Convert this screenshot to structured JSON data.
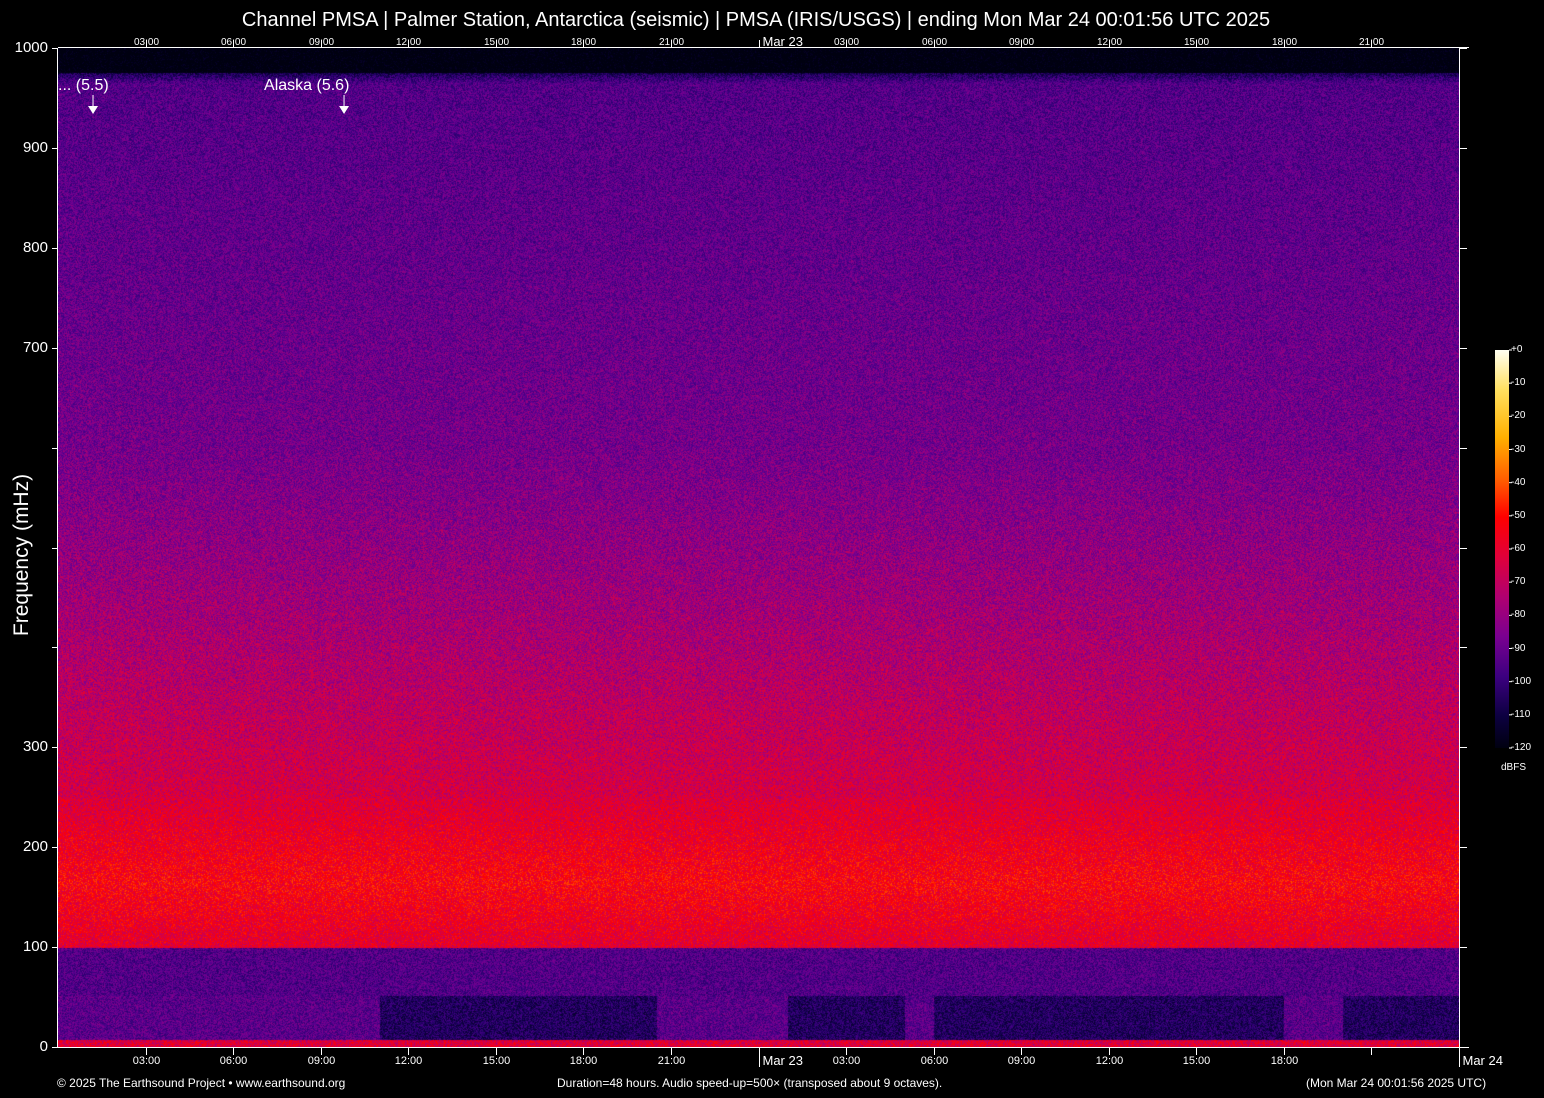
{
  "title": "Channel PMSA | Palmer Station, Antarctica (seismic) | PMSA (IRIS/USGS) | ending Mon Mar 24 00:01:56 UTC 2025",
  "chart_data": {
    "type": "heatmap",
    "title": "Channel PMSA | Palmer Station, Antarctica (seismic) | PMSA (IRIS/USGS) | ending Mon Mar 24 00:01:56 UTC 2025",
    "ylabel": "Frequency (mHz)",
    "ylim": [
      0,
      1000
    ],
    "y_ticks": [
      {
        "v": 1000,
        "label": "1000"
      },
      {
        "v": 900,
        "label": "900"
      },
      {
        "v": 800,
        "label": "800"
      },
      {
        "v": 700,
        "label": "700"
      },
      {
        "v": 600,
        "label": ""
      },
      {
        "v": 500,
        "label": ""
      },
      {
        "v": 400,
        "label": ""
      },
      {
        "v": 300,
        "label": "300"
      },
      {
        "v": 200,
        "label": "200"
      },
      {
        "v": 100,
        "label": "100"
      },
      {
        "v": 0,
        "label": "0"
      }
    ],
    "xlim_hours": [
      0,
      48
    ],
    "top_ticks": [
      {
        "h": 3,
        "label": "03:00"
      },
      {
        "h": 6,
        "label": "06:00"
      },
      {
        "h": 9,
        "label": "09:00"
      },
      {
        "h": 12,
        "label": "12:00"
      },
      {
        "h": 15,
        "label": "15:00"
      },
      {
        "h": 18,
        "label": "18:00"
      },
      {
        "h": 21,
        "label": "21:00"
      },
      {
        "h": 24,
        "label": "Mar 23"
      },
      {
        "h": 27,
        "label": "03:00"
      },
      {
        "h": 30,
        "label": "06:00"
      },
      {
        "h": 33,
        "label": "09:00"
      },
      {
        "h": 36,
        "label": "12:00"
      },
      {
        "h": 39,
        "label": "15:00"
      },
      {
        "h": 42,
        "label": "18:00"
      },
      {
        "h": 45,
        "label": "21:00"
      }
    ],
    "bottom_ticks": [
      {
        "h": 3,
        "label": "03:00"
      },
      {
        "h": 6,
        "label": "06:00"
      },
      {
        "h": 9,
        "label": "09:00"
      },
      {
        "h": 12,
        "label": "12:00"
      },
      {
        "h": 15,
        "label": "15:00"
      },
      {
        "h": 18,
        "label": "18:00"
      },
      {
        "h": 21,
        "label": "21:00"
      },
      {
        "h": 24,
        "label": "Mar 23"
      },
      {
        "h": 27,
        "label": "03:00"
      },
      {
        "h": 30,
        "label": "06:00"
      },
      {
        "h": 33,
        "label": "09:00"
      },
      {
        "h": 36,
        "label": "12:00"
      },
      {
        "h": 39,
        "label": "15:00"
      },
      {
        "h": 42,
        "label": "18:00"
      },
      {
        "h": 45,
        "label": ""
      },
      {
        "h": 48,
        "label": "Mar 24"
      }
    ],
    "annotations": [
      {
        "h": 1.2,
        "label": "... (5.5)"
      },
      {
        "h": 9.8,
        "label": "Alaska (5.6)"
      }
    ],
    "colorbar": {
      "unit": "dBFS",
      "ticks": [
        "+0",
        "-10",
        "-20",
        "-30",
        "-40",
        "-50",
        "-60",
        "-70",
        "-80",
        "-90",
        "-100",
        "-110",
        "-120"
      ],
      "range": [
        -120,
        0
      ]
    },
    "bands": [
      {
        "f_range": [
          0,
          50
        ],
        "level_dBFS": -95
      },
      {
        "f_range": [
          100,
          250
        ],
        "level_dBFS": -55
      },
      {
        "f_range": [
          250,
          600
        ],
        "level_dBFS": -75
      },
      {
        "f_range": [
          600,
          970
        ],
        "level_dBFS": -88
      }
    ]
  },
  "footer": {
    "left": "© 2025 The Earthsound Project • www.earthsound.org",
    "center": "Duration=48 hours. Audio speed-up=500× (transposed about 9 octaves).",
    "right": "(Mon Mar 24 00:01:56 2025 UTC)"
  }
}
